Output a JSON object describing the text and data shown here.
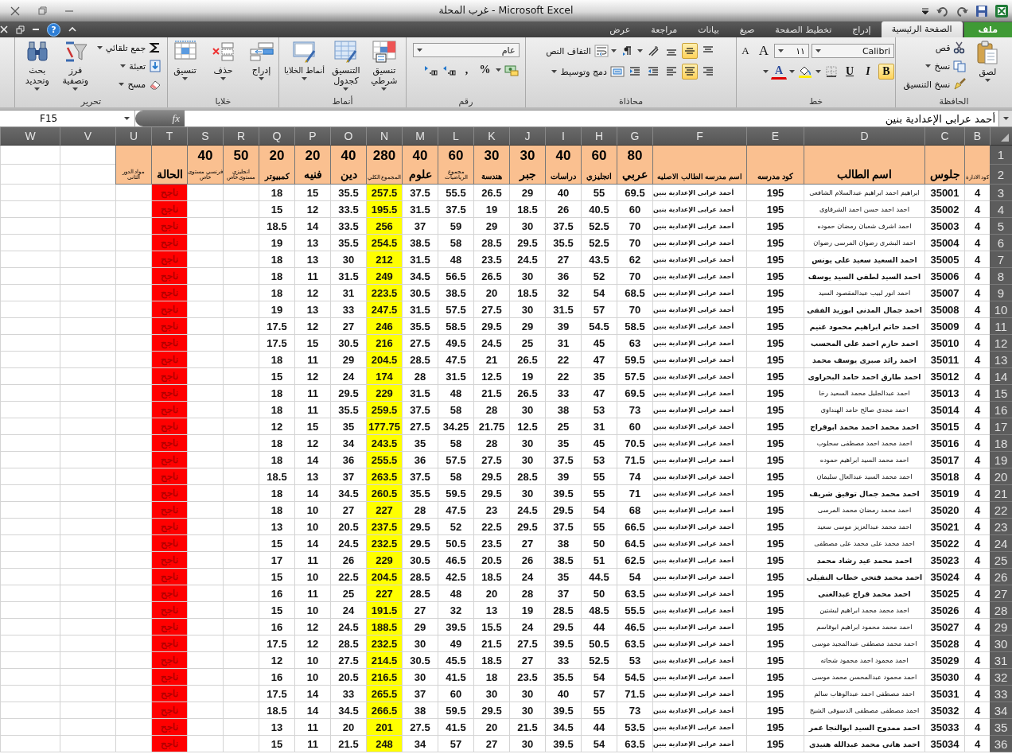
{
  "window": {
    "title": "غرب المحلة - Microsoft Excel",
    "help_glyph": "?"
  },
  "ribbon": {
    "tabs": [
      {
        "label": "ملف",
        "kind": "file",
        "selected": false
      },
      {
        "label": "الصفحة الرئيسية",
        "kind": "tab",
        "selected": true
      },
      {
        "label": "إدراج",
        "kind": "tab",
        "selected": false
      },
      {
        "label": "تخطيط الصفحة",
        "kind": "tab",
        "selected": false
      },
      {
        "label": "صيغ",
        "kind": "tab",
        "selected": false
      },
      {
        "label": "بيانات",
        "kind": "tab",
        "selected": false
      },
      {
        "label": "مراجعة",
        "kind": "tab",
        "selected": false
      },
      {
        "label": "عرض",
        "kind": "tab",
        "selected": false
      }
    ],
    "groups": [
      {
        "label": "الحافظة",
        "kind": "columns",
        "items": [
          [
            {
              "kind": "large",
              "label": "لصق",
              "menu": true
            }
          ],
          [
            {
              "kind": "small",
              "label": "قص"
            },
            {
              "kind": "small",
              "label": "نسخ",
              "menu": true
            },
            {
              "kind": "small",
              "label": "نسخ التنسيق"
            }
          ]
        ]
      },
      {
        "label": "خط",
        "kind": "rows",
        "items": [
          [
            {
              "kind": "combo",
              "value": "Calibri"
            },
            {
              "kind": "combo",
              "value": "١١"
            },
            {
              "kind": "glyph",
              "label": "A"
            },
            {
              "kind": "glyph",
              "label": "A"
            }
          ],
          [
            {
              "kind": "glyph",
              "label": "B",
              "selected": true
            },
            {
              "kind": "glyph",
              "label": "I",
              "selected": false
            },
            {
              "kind": "glyph",
              "label": "U",
              "selected": false
            },
            {
              "kind": "icon",
              "menu": true
            },
            {
              "kind": "icon",
              "menu": true
            },
            {
              "kind": "glyph",
              "label": "A",
              "menu": true
            }
          ]
        ]
      },
      {
        "label": "محاذاة",
        "kind": "rows",
        "items": [
          [
            {
              "kind": "icon",
              "selected": false
            },
            {
              "kind": "icon",
              "selected": true
            },
            {
              "kind": "icon",
              "selected": false
            },
            {
              "kind": "icon",
              "menu": true
            },
            {
              "kind": "icon",
              "menu": true
            },
            {
              "kind": "small",
              "label": "التفاف النص"
            }
          ],
          [
            {
              "kind": "icon",
              "selected": false
            },
            {
              "kind": "icon",
              "selected": true
            },
            {
              "kind": "icon",
              "selected": false
            },
            {
              "kind": "icon"
            },
            {
              "kind": "icon"
            },
            {
              "kind": "small",
              "label": "دمج وتوسيط",
              "menu": true
            }
          ]
        ]
      },
      {
        "label": "رقم",
        "kind": "rows",
        "items": [
          [
            {
              "kind": "combo",
              "value": "عام"
            }
          ],
          [
            {
              "kind": "icon",
              "menu": true
            },
            {
              "kind": "glyph",
              "label": "%"
            },
            {
              "kind": "glyph",
              "label": ","
            },
            {
              "kind": "icon"
            },
            {
              "kind": "icon"
            }
          ]
        ]
      },
      {
        "label": "أنماط",
        "kind": "columns",
        "items": [
          [
            {
              "kind": "large",
              "label": "تنسيق شرطي",
              "menu": true
            }
          ],
          [
            {
              "kind": "large",
              "label": "التنسيق كجدول",
              "menu": true
            }
          ],
          [
            {
              "kind": "large",
              "label": "أنماط الخلايا",
              "menu": true
            }
          ]
        ]
      },
      {
        "label": "خلايا",
        "kind": "columns",
        "items": [
          [
            {
              "kind": "large",
              "label": "إدراج",
              "menu": true
            }
          ],
          [
            {
              "kind": "large",
              "label": "حذف",
              "menu": true
            }
          ],
          [
            {
              "kind": "large",
              "label": "تنسيق",
              "menu": true
            }
          ]
        ]
      },
      {
        "label": "تحرير",
        "kind": "columns",
        "items": [
          [
            {
              "kind": "small",
              "label": "جمع تلقائي",
              "menu": true
            },
            {
              "kind": "small",
              "label": "تعبئة",
              "menu": true
            },
            {
              "kind": "small",
              "label": "مسح",
              "menu": true
            }
          ],
          [
            {
              "kind": "large",
              "label": "فرز وتصفية",
              "menu": true
            }
          ],
          [
            {
              "kind": "large",
              "label": "بحث وتحديد",
              "menu": true
            }
          ]
        ]
      }
    ]
  },
  "formula_bar": {
    "name_box": "F15",
    "function_label": "fx",
    "value": "أحمد عرابى الإعدادية بنين"
  },
  "sheet": {
    "columns": [
      {
        "letter": "B",
        "kind": "code",
        "label": "كود الادارة"
      },
      {
        "letter": "C",
        "kind": "code",
        "label": "جلوس"
      },
      {
        "letter": "D",
        "kind": "name",
        "label": "اسم الطالب"
      },
      {
        "letter": "E",
        "kind": "code",
        "label": "كود مدرسه"
      },
      {
        "letter": "F",
        "kind": "school",
        "label": "اسم مدرسه الطالب الاصليه"
      },
      {
        "letter": "G",
        "kind": "score",
        "max": "80",
        "label": "عربي"
      },
      {
        "letter": "H",
        "kind": "score",
        "max": "60",
        "label": "انجليزي"
      },
      {
        "letter": "I",
        "kind": "score",
        "max": "40",
        "label": "دراسات"
      },
      {
        "letter": "J",
        "kind": "score",
        "max": "30",
        "label": "جبر"
      },
      {
        "letter": "K",
        "kind": "score",
        "max": "30",
        "label": "هندسة"
      },
      {
        "letter": "L",
        "kind": "score",
        "max": "60",
        "label": "مجموع الرياضيات"
      },
      {
        "letter": "M",
        "kind": "score",
        "max": "40",
        "label": "علوم"
      },
      {
        "letter": "N",
        "kind": "score",
        "max": "280",
        "label": "المجموع الكلي",
        "color": "#ffff00"
      },
      {
        "letter": "O",
        "kind": "score",
        "max": "40",
        "label": "دين"
      },
      {
        "letter": "P",
        "kind": "score",
        "max": "20",
        "label": "فنيه"
      },
      {
        "letter": "Q",
        "kind": "score",
        "max": "20",
        "label": "كمبيوتر"
      },
      {
        "letter": "R",
        "kind": "extra",
        "max": "50",
        "label": "انجليزي مستوى خاص"
      },
      {
        "letter": "S",
        "kind": "extra",
        "max": "40",
        "label": "فرنسي مستوى خاص"
      },
      {
        "letter": "T",
        "kind": "status",
        "label": "الحالة",
        "color": "#ff0000"
      },
      {
        "letter": "U",
        "kind": "extra",
        "label": "مواد الدور الثانى"
      },
      {
        "letter": "V",
        "kind": "blank"
      },
      {
        "letter": "W",
        "kind": "blank"
      }
    ],
    "header_rows": [
      "1",
      "2"
    ],
    "rows": [
      {
        "number": "3",
        "name_bold": false,
        "status": "ناجح",
        "values": [
          "4",
          "35001",
          "ابراهيم احمد ابراهيم عبدالسلام الشافعى",
          "195",
          "أحمد عرابى الإعدادية بنين",
          "69.5",
          "55",
          "40",
          "29",
          "26.5",
          "55.5",
          "37.5",
          "257.5",
          "35.5",
          "15",
          "18"
        ]
      },
      {
        "number": "4",
        "name_bold": false,
        "status": "ناجح",
        "values": [
          "4",
          "35002",
          "احمد احمد حسن احمد الشرقاوى",
          "195",
          "أحمد عرابى الإعدادية بنين",
          "60",
          "40.5",
          "26",
          "18.5",
          "19",
          "37.5",
          "31.5",
          "195.5",
          "33.5",
          "12",
          "15"
        ]
      },
      {
        "number": "5",
        "name_bold": false,
        "status": "ناجح",
        "values": [
          "4",
          "35003",
          "احمد اشرف شعبان رمضان حموده",
          "195",
          "أحمد عرابى الإعدادية بنين",
          "70",
          "52.5",
          "37.5",
          "30",
          "29",
          "59",
          "37",
          "256",
          "33.5",
          "14",
          "18.5"
        ]
      },
      {
        "number": "6",
        "name_bold": false,
        "status": "ناجح",
        "values": [
          "4",
          "35004",
          "احمد البشرى رضوان المرسى رضوان",
          "195",
          "أحمد عرابى الإعدادية بنين",
          "70",
          "52.5",
          "35.5",
          "29.5",
          "28.5",
          "58",
          "38.5",
          "254.5",
          "35.5",
          "13",
          "19"
        ]
      },
      {
        "number": "7",
        "name_bold": true,
        "status": "ناجح",
        "values": [
          "4",
          "35005",
          "احمد السعيد سعيد على يونس",
          "195",
          "أحمد عرابى الإعدادية بنين",
          "62",
          "43.5",
          "27",
          "24.5",
          "23.5",
          "48",
          "31.5",
          "212",
          "30",
          "13",
          "18"
        ]
      },
      {
        "number": "8",
        "name_bold": true,
        "status": "ناجح",
        "values": [
          "4",
          "35006",
          "احمد السيد لطفى السيد يوسف",
          "195",
          "أحمد عرابى الإعدادية بنين",
          "70",
          "52",
          "36",
          "30",
          "26.5",
          "56.5",
          "34.5",
          "249",
          "31.5",
          "11",
          "18"
        ]
      },
      {
        "number": "9",
        "name_bold": false,
        "status": "ناجح",
        "values": [
          "4",
          "35007",
          "احمد انور لبيب عبدالمقصود السيد",
          "195",
          "أحمد عرابى الإعدادية بنين",
          "68.5",
          "54",
          "32",
          "18.5",
          "20",
          "38.5",
          "30.5",
          "223.5",
          "31",
          "12",
          "18"
        ]
      },
      {
        "number": "10",
        "name_bold": true,
        "status": "ناجح",
        "values": [
          "4",
          "35008",
          "احمد جمال المدنى ابوزيد الفقى",
          "195",
          "أحمد عرابى الإعدادية بنين",
          "70",
          "57",
          "31.5",
          "30",
          "27.5",
          "57.5",
          "31.5",
          "247.5",
          "33",
          "13",
          "19"
        ]
      },
      {
        "number": "11",
        "name_bold": true,
        "status": "ناجح",
        "values": [
          "4",
          "35009",
          "احمد حاتم ابراهيم محمود غنيم",
          "195",
          "أحمد عرابى الإعدادية بنين",
          "58.5",
          "54.5",
          "39",
          "29",
          "29.5",
          "58.5",
          "35.5",
          "246",
          "27",
          "12",
          "17.5"
        ]
      },
      {
        "number": "12",
        "name_bold": true,
        "status": "ناجح",
        "values": [
          "4",
          "35010",
          "احمد حازم احمد على المحسب",
          "195",
          "أحمد عرابى الإعدادية بنين",
          "63",
          "45",
          "31",
          "25",
          "24.5",
          "49.5",
          "27.5",
          "216",
          "30.5",
          "15",
          "17.5"
        ]
      },
      {
        "number": "13",
        "name_bold": true,
        "status": "ناجح",
        "values": [
          "4",
          "35011",
          "احمد رائد صبرى يوسف محمد",
          "195",
          "أحمد عرابى الإعدادية بنين",
          "59.5",
          "47",
          "22",
          "26.5",
          "21",
          "47.5",
          "28.5",
          "204.5",
          "29",
          "11",
          "18"
        ]
      },
      {
        "number": "14",
        "name_bold": true,
        "status": "ناجح",
        "values": [
          "4",
          "35012",
          "احمد طارق احمد حامد البحراوى",
          "195",
          "أحمد عرابى الإعدادية بنين",
          "57.5",
          "35",
          "22",
          "19",
          "12.5",
          "31.5",
          "28",
          "174",
          "24",
          "12",
          "15"
        ]
      },
      {
        "number": "15",
        "name_bold": false,
        "status": "ناجح",
        "values": [
          "4",
          "35013",
          "احمد عبدالجليل محمد السعيد رخا",
          "195",
          "أحمد عرابى الإعدادية بنين",
          "69.5",
          "47",
          "33",
          "26.5",
          "21.5",
          "48",
          "31.5",
          "229",
          "29.5",
          "11",
          "18"
        ]
      },
      {
        "number": "16",
        "name_bold": false,
        "status": "ناجح",
        "values": [
          "4",
          "35014",
          "احمد مجدى صالح حامد الهنداوى",
          "195",
          "أحمد عرابى الإعدادية بنين",
          "73",
          "53",
          "38",
          "30",
          "28",
          "58",
          "37.5",
          "259.5",
          "35.5",
          "11",
          "18"
        ]
      },
      {
        "number": "17",
        "name_bold": true,
        "status": "ناجح",
        "values": [
          "4",
          "35015",
          "احمد محمد احمد محمد ابوفراج",
          "195",
          "أحمد عرابى الإعدادية بنين",
          "60",
          "31",
          "25",
          "12.5",
          "21.75",
          "34.25",
          "27.5",
          "177.75",
          "35",
          "15",
          "12"
        ]
      },
      {
        "number": "18",
        "name_bold": false,
        "status": "ناجح",
        "values": [
          "4",
          "35016",
          "احمد محمد احمد مصطفى سحلوب",
          "195",
          "أحمد عرابى الإعدادية بنين",
          "70.5",
          "45",
          "35",
          "30",
          "28",
          "58",
          "35",
          "243.5",
          "34",
          "12",
          "18"
        ]
      },
      {
        "number": "19",
        "name_bold": false,
        "status": "ناجح",
        "values": [
          "4",
          "35017",
          "احمد محمد السيد ابراهيم حموده",
          "195",
          "أحمد عرابى الإعدادية بنين",
          "71.5",
          "53",
          "37.5",
          "30",
          "27.5",
          "57.5",
          "36",
          "255.5",
          "36",
          "14",
          "18"
        ]
      },
      {
        "number": "20",
        "name_bold": false,
        "status": "ناجح",
        "values": [
          "4",
          "35018",
          "احمد محمد السيد عبدالعال سليمان",
          "195",
          "أحمد عرابى الإعدادية بنين",
          "74",
          "55",
          "39",
          "28.5",
          "29.5",
          "58",
          "37.5",
          "263.5",
          "37",
          "13",
          "18.5"
        ]
      },
      {
        "number": "21",
        "name_bold": true,
        "status": "ناجح",
        "values": [
          "4",
          "35019",
          "احمد محمد جمال توفيق شريف",
          "195",
          "أحمد عرابى الإعدادية بنين",
          "71",
          "55",
          "39.5",
          "30",
          "29.5",
          "59.5",
          "35.5",
          "260.5",
          "34.5",
          "14",
          "18"
        ]
      },
      {
        "number": "22",
        "name_bold": false,
        "status": "ناجح",
        "values": [
          "4",
          "35020",
          "احمد محمد رمضان محمد المرسى",
          "195",
          "أحمد عرابى الإعدادية بنين",
          "68",
          "54",
          "29.5",
          "24.5",
          "23",
          "47.5",
          "28",
          "227",
          "27",
          "10",
          "18"
        ]
      },
      {
        "number": "23",
        "name_bold": false,
        "status": "ناجح",
        "values": [
          "4",
          "35021",
          "احمد محمد عبدالعزيز موسى سعيد",
          "195",
          "أحمد عرابى الإعدادية بنين",
          "66.5",
          "55",
          "37.5",
          "29.5",
          "22.5",
          "52",
          "29.5",
          "237.5",
          "20.5",
          "10",
          "13"
        ]
      },
      {
        "number": "24",
        "name_bold": false,
        "status": "ناجح",
        "values": [
          "4",
          "35022",
          "احمد محمد على محمد على مصطفى",
          "195",
          "أحمد عرابى الإعدادية بنين",
          "64.5",
          "50",
          "38",
          "27",
          "23.5",
          "50.5",
          "29.5",
          "232.5",
          "24.5",
          "14",
          "15"
        ]
      },
      {
        "number": "25",
        "name_bold": true,
        "status": "ناجح",
        "values": [
          "4",
          "35023",
          "احمد محمد عيد رشاد محمد",
          "195",
          "أحمد عرابى الإعدادية بنين",
          "62.5",
          "51",
          "38.5",
          "26",
          "20.5",
          "46.5",
          "30.5",
          "229",
          "26",
          "11",
          "17"
        ]
      },
      {
        "number": "26",
        "name_bold": true,
        "status": "ناجح",
        "values": [
          "4",
          "35024",
          "احمد محمد فتحى خطاب النفيلى",
          "195",
          "أحمد عرابى الإعدادية بنين",
          "54",
          "44.5",
          "35",
          "24",
          "18.5",
          "42.5",
          "28.5",
          "204.5",
          "22.5",
          "10",
          "15"
        ]
      },
      {
        "number": "27",
        "name_bold": true,
        "status": "ناجح",
        "values": [
          "4",
          "35025",
          "احمد محمد فراج عبدالغنى",
          "195",
          "أحمد عرابى الإعدادية بنين",
          "63.5",
          "50",
          "37",
          "28",
          "20",
          "48",
          "28.5",
          "227",
          "25",
          "11",
          "16"
        ]
      },
      {
        "number": "28",
        "name_bold": false,
        "status": "ناجح",
        "values": [
          "4",
          "35026",
          "احمد محمد محمد ابراهيم لبشتين",
          "195",
          "أحمد عرابى الإعدادية بنين",
          "55.5",
          "48.5",
          "28.5",
          "19",
          "13",
          "32",
          "27",
          "191.5",
          "24",
          "10",
          "15"
        ]
      },
      {
        "number": "29",
        "name_bold": false,
        "status": "ناجح",
        "values": [
          "4",
          "35027",
          "احمد محمد محمود ابراهيم ابوقاسم",
          "195",
          "أحمد عرابى الإعدادية بنين",
          "46.5",
          "44",
          "29.5",
          "24",
          "15.5",
          "39.5",
          "29",
          "188.5",
          "24.5",
          "12",
          "16"
        ]
      },
      {
        "number": "30",
        "name_bold": false,
        "status": "ناجح",
        "values": [
          "4",
          "35028",
          "احمد محمد مصطفى عبدالمجيد موسى",
          "195",
          "أحمد عرابى الإعدادية بنين",
          "63.5",
          "50.5",
          "39.5",
          "27.5",
          "21.5",
          "49",
          "30",
          "232.5",
          "28.5",
          "12",
          "17.5"
        ]
      },
      {
        "number": "31",
        "name_bold": false,
        "status": "ناجح",
        "values": [
          "4",
          "35029",
          "احمد محمود احمد محمود شحاته",
          "195",
          "أحمد عرابى الإعدادية بنين",
          "53",
          "52.5",
          "33",
          "27",
          "18.5",
          "45.5",
          "30.5",
          "214.5",
          "27.5",
          "10",
          "12"
        ]
      },
      {
        "number": "32",
        "name_bold": false,
        "status": "ناجح",
        "values": [
          "4",
          "35030",
          "احمد محمود عبدالمحسن محمد موسى",
          "195",
          "أحمد عرابى الإعدادية بنين",
          "54.5",
          "54",
          "35.5",
          "23.5",
          "18",
          "41.5",
          "30",
          "216.5",
          "20.5",
          "10",
          "16"
        ]
      },
      {
        "number": "33",
        "name_bold": false,
        "status": "ناجح",
        "values": [
          "4",
          "35031",
          "احمد مصطفى احمد عبدالوهاب سالم",
          "195",
          "أحمد عرابى الإعدادية بنين",
          "71.5",
          "57",
          "40",
          "30",
          "30",
          "60",
          "37",
          "265.5",
          "33",
          "14",
          "17.5"
        ]
      },
      {
        "number": "34",
        "name_bold": false,
        "status": "ناجح",
        "values": [
          "4",
          "35032",
          "احمد مصطفى مصطفى الدسوقى الشيخ",
          "195",
          "أحمد عرابى الإعدادية بنين",
          "73",
          "55",
          "39.5",
          "30",
          "29.5",
          "59.5",
          "38",
          "266.5",
          "34.5",
          "14",
          "18.5"
        ]
      },
      {
        "number": "35",
        "name_bold": true,
        "status": "ناجح",
        "values": [
          "4",
          "35033",
          "احمد ممدوح السيد ابوالنجا عمر",
          "195",
          "أحمد عرابى الإعدادية بنين",
          "53.5",
          "44",
          "34.5",
          "21.5",
          "20",
          "41.5",
          "27.5",
          "201",
          "20",
          "11",
          "13"
        ]
      },
      {
        "number": "36",
        "name_bold": true,
        "status": "ناجح",
        "values": [
          "4",
          "35034",
          "احمد هانى محمد عبدالله هنيدى",
          "195",
          "أحمد عرابى الإعدادية بنين",
          "63.5",
          "54",
          "39.5",
          "30",
          "27",
          "57",
          "34",
          "248",
          "21.5",
          "11",
          "15"
        ]
      }
    ]
  }
}
